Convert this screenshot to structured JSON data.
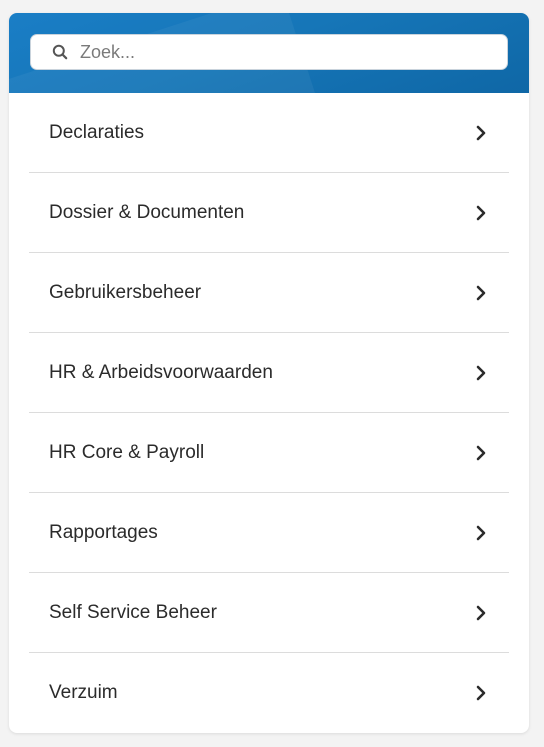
{
  "search": {
    "placeholder": "Zoek...",
    "value": ""
  },
  "menu": {
    "items": [
      {
        "label": "Declaraties"
      },
      {
        "label": "Dossier & Documenten"
      },
      {
        "label": "Gebruikersbeheer"
      },
      {
        "label": "HR & Arbeidsvoorwaarden"
      },
      {
        "label": "HR Core & Payroll"
      },
      {
        "label": "Rapportages"
      },
      {
        "label": "Self Service Beheer"
      },
      {
        "label": "Verzuim"
      }
    ],
    "item_icon": "chevron-right-icon"
  },
  "colors": {
    "header": "#1676b8",
    "text": "#2b2b2b",
    "divider": "#dcdcdc"
  }
}
